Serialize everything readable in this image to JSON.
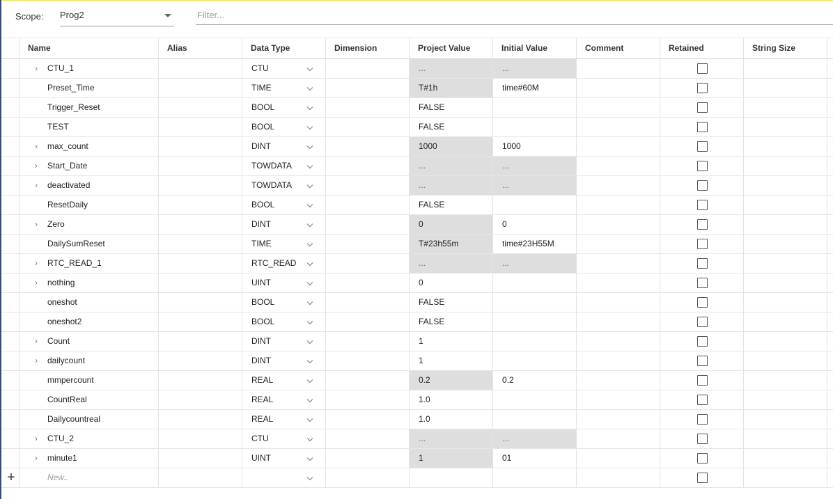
{
  "toolbar": {
    "scope_label": "Scope:",
    "scope_value": "Prog2",
    "filter_placeholder": "Filter..."
  },
  "columns": [
    "Name",
    "Alias",
    "Data Type",
    "Dimension",
    "Project Value",
    "Initial Value",
    "Comment",
    "Retained",
    "String Size"
  ],
  "rows": [
    {
      "name": "CTU_1",
      "expandable": true,
      "alias": "",
      "type": "CTU",
      "dimension": "",
      "project_value": "...",
      "pv_shaded": true,
      "initial_value": "...",
      "iv_shaded": true,
      "comment": "",
      "retained": false,
      "string_size": ""
    },
    {
      "name": "Preset_Time",
      "expandable": false,
      "alias": "",
      "type": "TIME",
      "dimension": "",
      "project_value": "T#1h",
      "pv_shaded": true,
      "initial_value": "time#60M",
      "iv_shaded": false,
      "comment": "",
      "retained": false,
      "string_size": ""
    },
    {
      "name": "Trigger_Reset",
      "expandable": false,
      "alias": "",
      "type": "BOOL",
      "dimension": "",
      "project_value": "FALSE",
      "pv_shaded": false,
      "initial_value": "",
      "iv_shaded": false,
      "comment": "",
      "retained": false,
      "string_size": ""
    },
    {
      "name": "TEST",
      "expandable": false,
      "alias": "",
      "type": "BOOL",
      "dimension": "",
      "project_value": "FALSE",
      "pv_shaded": false,
      "initial_value": "",
      "iv_shaded": false,
      "comment": "",
      "retained": false,
      "string_size": ""
    },
    {
      "name": "max_count",
      "expandable": true,
      "alias": "",
      "type": "DINT",
      "dimension": "",
      "project_value": "1000",
      "pv_shaded": true,
      "initial_value": "1000",
      "iv_shaded": false,
      "comment": "",
      "retained": false,
      "string_size": ""
    },
    {
      "name": "Start_Date",
      "expandable": true,
      "alias": "",
      "type": "TOWDATA",
      "dimension": "",
      "project_value": "...",
      "pv_shaded": true,
      "initial_value": "...",
      "iv_shaded": true,
      "comment": "",
      "retained": false,
      "string_size": ""
    },
    {
      "name": "deactivated",
      "expandable": true,
      "alias": "",
      "type": "TOWDATA",
      "dimension": "",
      "project_value": "...",
      "pv_shaded": true,
      "initial_value": "...",
      "iv_shaded": true,
      "comment": "",
      "retained": false,
      "string_size": ""
    },
    {
      "name": "ResetDaily",
      "expandable": false,
      "alias": "",
      "type": "BOOL",
      "dimension": "",
      "project_value": "FALSE",
      "pv_shaded": false,
      "initial_value": "",
      "iv_shaded": false,
      "comment": "",
      "retained": false,
      "string_size": ""
    },
    {
      "name": "Zero",
      "expandable": true,
      "alias": "",
      "type": "DINT",
      "dimension": "",
      "project_value": "0",
      "pv_shaded": true,
      "initial_value": "0",
      "iv_shaded": false,
      "comment": "",
      "retained": false,
      "string_size": ""
    },
    {
      "name": "DailySumReset",
      "expandable": false,
      "alias": "",
      "type": "TIME",
      "dimension": "",
      "project_value": "T#23h55m",
      "pv_shaded": true,
      "initial_value": "time#23H55M",
      "iv_shaded": false,
      "comment": "",
      "retained": false,
      "string_size": ""
    },
    {
      "name": "RTC_READ_1",
      "expandable": true,
      "alias": "",
      "type": "RTC_READ",
      "dimension": "",
      "project_value": "...",
      "pv_shaded": true,
      "initial_value": "...",
      "iv_shaded": true,
      "comment": "",
      "retained": false,
      "string_size": ""
    },
    {
      "name": "nothing",
      "expandable": true,
      "alias": "",
      "type": "UINT",
      "dimension": "",
      "project_value": "0",
      "pv_shaded": false,
      "initial_value": "",
      "iv_shaded": false,
      "comment": "",
      "retained": false,
      "string_size": ""
    },
    {
      "name": "oneshot",
      "expandable": false,
      "alias": "",
      "type": "BOOL",
      "dimension": "",
      "project_value": "FALSE",
      "pv_shaded": false,
      "initial_value": "",
      "iv_shaded": false,
      "comment": "",
      "retained": false,
      "string_size": ""
    },
    {
      "name": "oneshot2",
      "expandable": false,
      "alias": "",
      "type": "BOOL",
      "dimension": "",
      "project_value": "FALSE",
      "pv_shaded": false,
      "initial_value": "",
      "iv_shaded": false,
      "comment": "",
      "retained": false,
      "string_size": ""
    },
    {
      "name": "Count",
      "expandable": true,
      "alias": "",
      "type": "DINT",
      "dimension": "",
      "project_value": "1",
      "pv_shaded": false,
      "initial_value": "",
      "iv_shaded": false,
      "comment": "",
      "retained": false,
      "string_size": ""
    },
    {
      "name": "dailycount",
      "expandable": true,
      "alias": "",
      "type": "DINT",
      "dimension": "",
      "project_value": "1",
      "pv_shaded": false,
      "initial_value": "",
      "iv_shaded": false,
      "comment": "",
      "retained": false,
      "string_size": ""
    },
    {
      "name": "mmpercount",
      "expandable": false,
      "alias": "",
      "type": "REAL",
      "dimension": "",
      "project_value": "0.2",
      "pv_shaded": true,
      "initial_value": "0.2",
      "iv_shaded": false,
      "comment": "",
      "retained": false,
      "string_size": ""
    },
    {
      "name": "CountReal",
      "expandable": false,
      "alias": "",
      "type": "REAL",
      "dimension": "",
      "project_value": "1.0",
      "pv_shaded": false,
      "initial_value": "",
      "iv_shaded": false,
      "comment": "",
      "retained": false,
      "string_size": ""
    },
    {
      "name": "Dailycountreal",
      "expandable": false,
      "alias": "",
      "type": "REAL",
      "dimension": "",
      "project_value": "1.0",
      "pv_shaded": false,
      "initial_value": "",
      "iv_shaded": false,
      "comment": "",
      "retained": false,
      "string_size": ""
    },
    {
      "name": "CTU_2",
      "expandable": true,
      "alias": "",
      "type": "CTU",
      "dimension": "",
      "project_value": "...",
      "pv_shaded": true,
      "initial_value": "...",
      "iv_shaded": true,
      "comment": "",
      "retained": false,
      "string_size": ""
    },
    {
      "name": "minute1",
      "expandable": true,
      "alias": "",
      "type": "UINT",
      "dimension": "",
      "project_value": "1",
      "pv_shaded": true,
      "initial_value": "01",
      "iv_shaded": false,
      "comment": "",
      "retained": false,
      "string_size": ""
    }
  ],
  "new_row": {
    "placeholder": "New..",
    "add_icon": "plus-icon",
    "retained": false
  },
  "icons": {
    "expander": "chevron-right-icon",
    "dropdown": "chevron-down-icon",
    "scope_caret": "caret-down-icon"
  },
  "colors": {
    "shaded_cell": "#dedede",
    "top_accent": "#f3ea86",
    "left_border": "#3a4a7a"
  }
}
